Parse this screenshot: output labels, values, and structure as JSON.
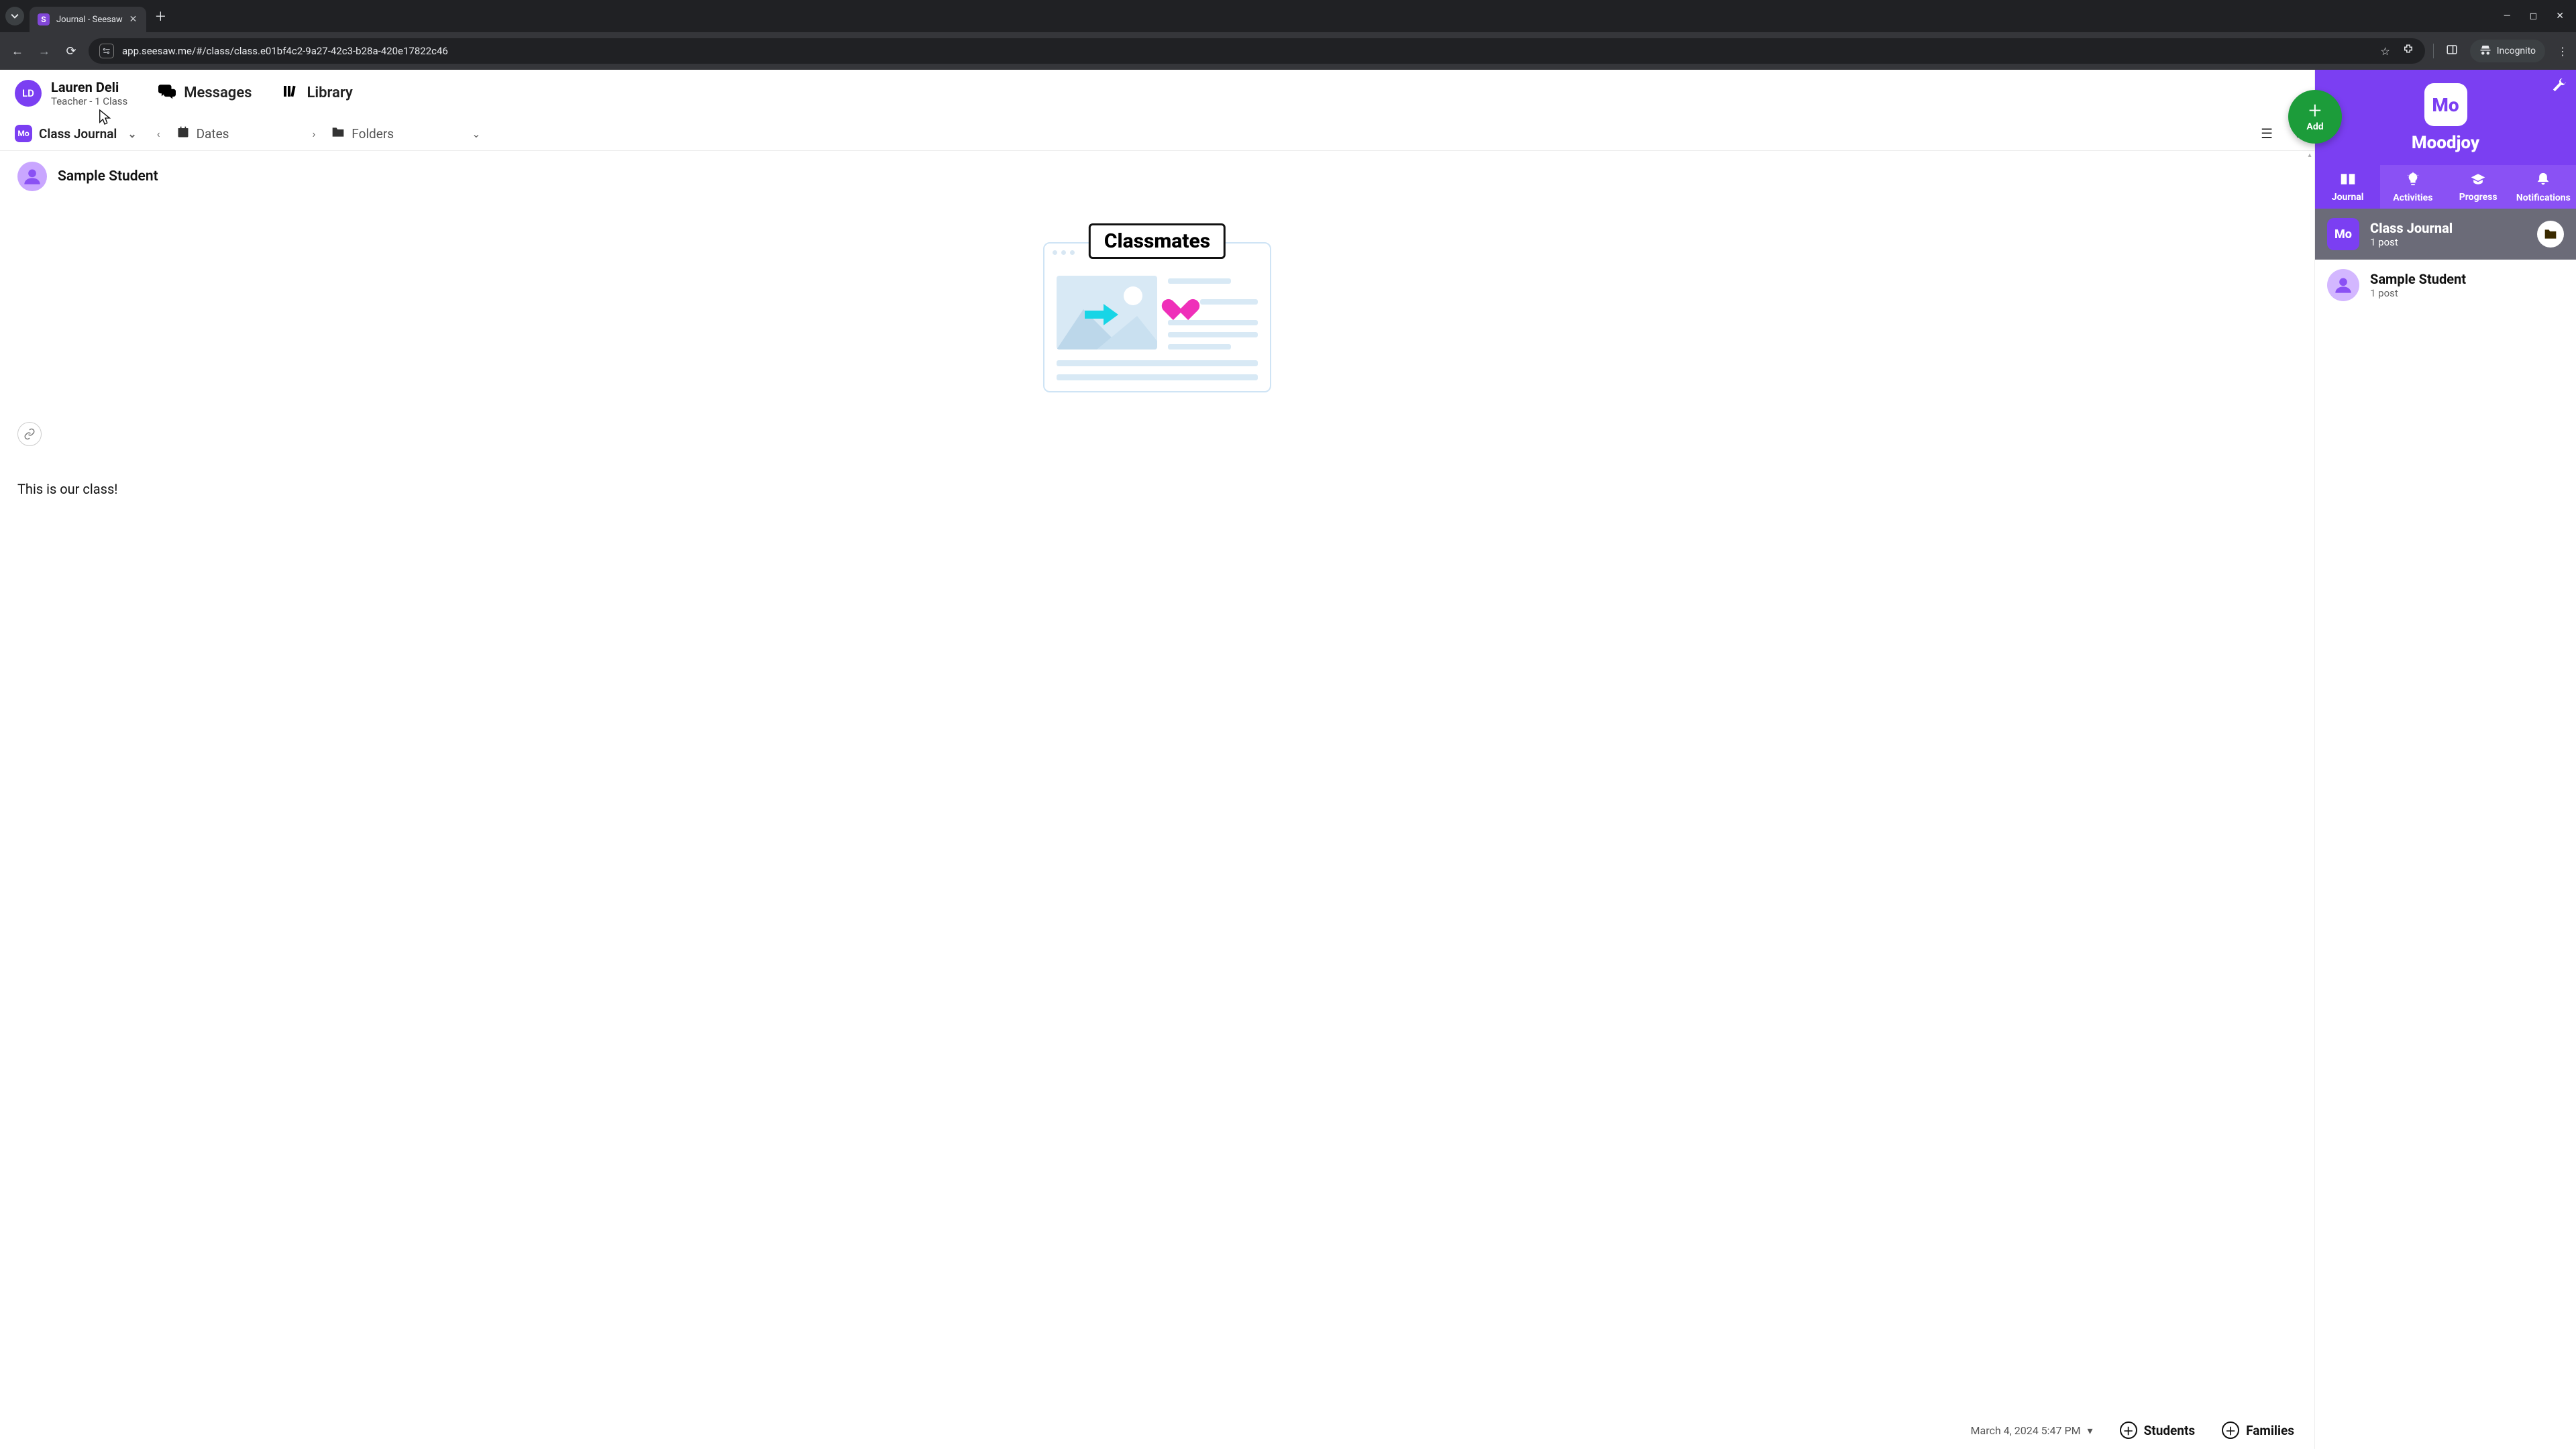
{
  "browser": {
    "tab_title": "Journal - Seesaw",
    "url": "app.seesaw.me/#/class/class.e01bf4c2-9a27-42c3-b28a-420e17822c46",
    "incognito_label": "Incognito"
  },
  "user": {
    "initials": "LD",
    "name": "Lauren Deli",
    "role": "Teacher - 1 Class"
  },
  "topnav": {
    "messages": "Messages",
    "library": "Library"
  },
  "filters": {
    "class_badge": "Mo",
    "class_name": "Class Journal",
    "dates": "Dates",
    "folders": "Folders"
  },
  "post": {
    "student_name": "Sample Student",
    "classmates_label": "Classmates",
    "caption": "This is our class!",
    "timestamp": "March 4, 2024 5:47 PM"
  },
  "bottom": {
    "students": "Students",
    "families": "Families"
  },
  "add": {
    "label": "Add"
  },
  "side": {
    "class_badge": "Mo",
    "class_name": "Moodjoy",
    "tabs": {
      "journal": "Journal",
      "activities": "Activities",
      "progress": "Progress",
      "notifications": "Notifications"
    },
    "rows": {
      "class_journal": {
        "badge": "Mo",
        "title": "Class Journal",
        "subtitle": "1 post"
      },
      "sample_student": {
        "title": "Sample Student",
        "subtitle": "1 post"
      }
    }
  }
}
